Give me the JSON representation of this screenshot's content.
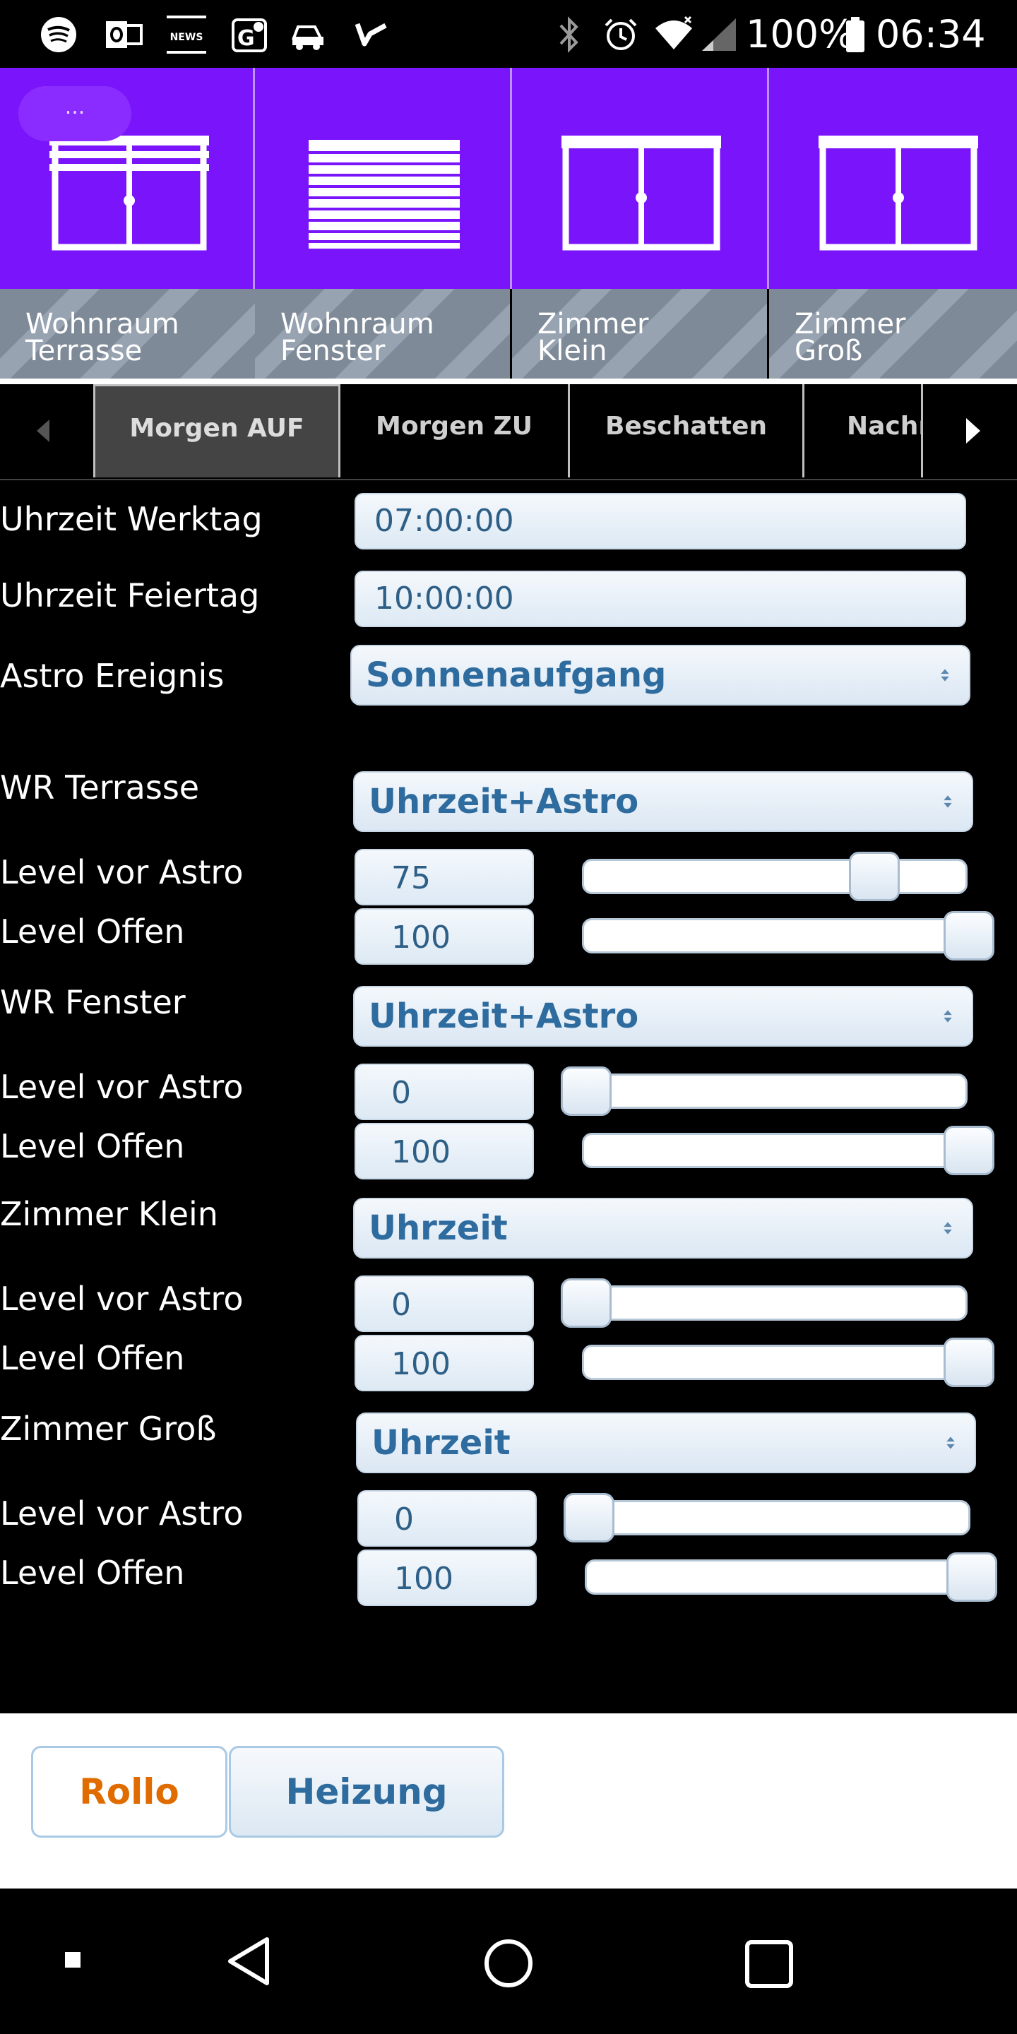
{
  "status_bar": {
    "battery": "100%",
    "time": "06:34",
    "icons": [
      "spotify-icon",
      "outlook-icon",
      "suedtirol-news-icon",
      "maps-icon",
      "car-icon",
      "tasks-icon",
      "bluetooth-icon",
      "alarm-icon",
      "wifi-icon",
      "signal-icon",
      "battery-icon"
    ],
    "news_icon_text": "NEWS"
  },
  "tiles": {
    "more_label": "...",
    "items": [
      {
        "label": "Wohnraum\nTerrasse",
        "icon": "window-blind-half-icon"
      },
      {
        "label": "Wohnraum\nFenster",
        "icon": "window-blind-closed-icon"
      },
      {
        "label": "Zimmer\nKlein",
        "icon": "window-open-icon"
      },
      {
        "label": "Zimmer\nGroß",
        "icon": "window-open-icon"
      }
    ]
  },
  "tabs": {
    "items": [
      "Morgen AUF",
      "Morgen ZU",
      "Beschatten",
      "Nachr"
    ],
    "active": "Morgen AUF"
  },
  "form": {
    "uhrzeit_werktag": {
      "label": "Uhrzeit Werktag",
      "value": "07:00:00"
    },
    "uhrzeit_feiertag": {
      "label": "Uhrzeit Feiertag",
      "value": "10:00:00"
    },
    "astro_ereignis": {
      "label": "Astro Ereignis",
      "value": "Sonnenaufgang"
    },
    "groups": [
      {
        "label": "WR Terrasse",
        "mode": "Uhrzeit+Astro",
        "level_vor_astro": {
          "label": "Level vor Astro",
          "value": "75",
          "fraction": 0.75
        },
        "level_offen": {
          "label": "Level Offen",
          "value": "100",
          "fraction": 1.0
        }
      },
      {
        "label": "WR Fenster",
        "mode": "Uhrzeit+Astro",
        "level_vor_astro": {
          "label": "Level vor Astro",
          "value": "0",
          "fraction": 0.0
        },
        "level_offen": {
          "label": "Level Offen",
          "value": "100",
          "fraction": 1.0
        }
      },
      {
        "label": "Zimmer Klein",
        "mode": "Uhrzeit",
        "level_vor_astro": {
          "label": "Level vor Astro",
          "value": "0",
          "fraction": 0.0
        },
        "level_offen": {
          "label": "Level Offen",
          "value": "100",
          "fraction": 1.0
        }
      },
      {
        "label": "Zimmer Groß",
        "mode": "Uhrzeit",
        "level_vor_astro": {
          "label": "Level vor Astro",
          "value": "0",
          "fraction": 0.0
        },
        "level_offen": {
          "label": "Level Offen",
          "value": "100",
          "fraction": 1.0
        }
      }
    ]
  },
  "bottom_tabs": {
    "rollo": "Rollo",
    "heizung": "Heizung",
    "active": "Rollo",
    "active_color": "#e06c00",
    "inactive_color": "#2e6b9e"
  },
  "colors": {
    "tile_purple": "#7a14fa",
    "field_text": "#2e5f86"
  }
}
